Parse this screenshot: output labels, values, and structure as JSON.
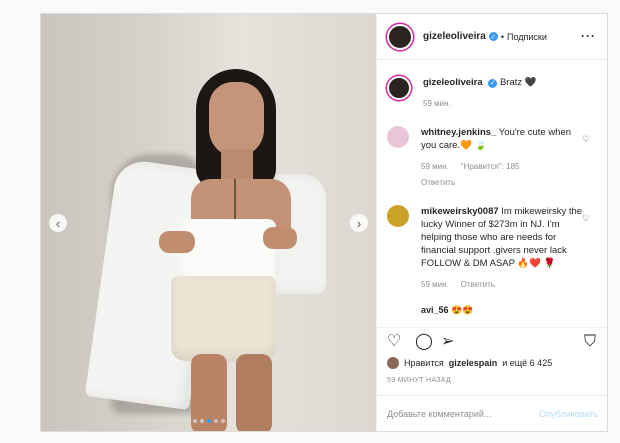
{
  "post": {
    "image_alt": "",
    "nav_prev_glyph": "‹",
    "nav_next_glyph": "›",
    "carousel_count": 5,
    "carousel_active": 3
  },
  "header": {
    "username": "gizeleoliveira",
    "verified_glyph": "✓",
    "separator": "•",
    "follow_label": "Подписки",
    "more_glyph": "···"
  },
  "comments": [
    {
      "username": "gizeleoliveira",
      "verified": true,
      "text": "Bratz 🖤",
      "time": "59 мин.",
      "likes_label": "",
      "reply_label": ""
    },
    {
      "username": "whitney.jenkins_",
      "text": "You're cute when you care.🧡 🍃",
      "time": "59 мин.",
      "likes_label": "\"Нравится\": 185",
      "reply_label": "Ответить"
    },
    {
      "username": "mikeweirsky0087",
      "text": "Im mikeweirsky the lucky Winner of $273m in NJ. I'm helping those who are needs for financial support .givers never lack FOLLOW & DM ASAP 🔥❤️ 🌹",
      "time": "59 мин.",
      "likes_label": "",
      "reply_label": "Ответить"
    }
  ],
  "peek_comment": "avi_56 😍😍",
  "actions": {
    "like_icon": "♡",
    "comment_icon": "◯",
    "share_icon": "➢",
    "save_icon": "⛉"
  },
  "likes": {
    "prefix": "Нравится",
    "user": "gizelespain",
    "suffix": "и ещё 6 425"
  },
  "timestamp": "59 МИНУТ НАЗАД",
  "add_comment": {
    "placeholder": "Добавьте комментарий...",
    "publish_label": "Опубликовать"
  },
  "colors": {
    "accent": "#3897f0",
    "story_ring": "#d6249f",
    "publish_disabled": "#b2dffc"
  }
}
